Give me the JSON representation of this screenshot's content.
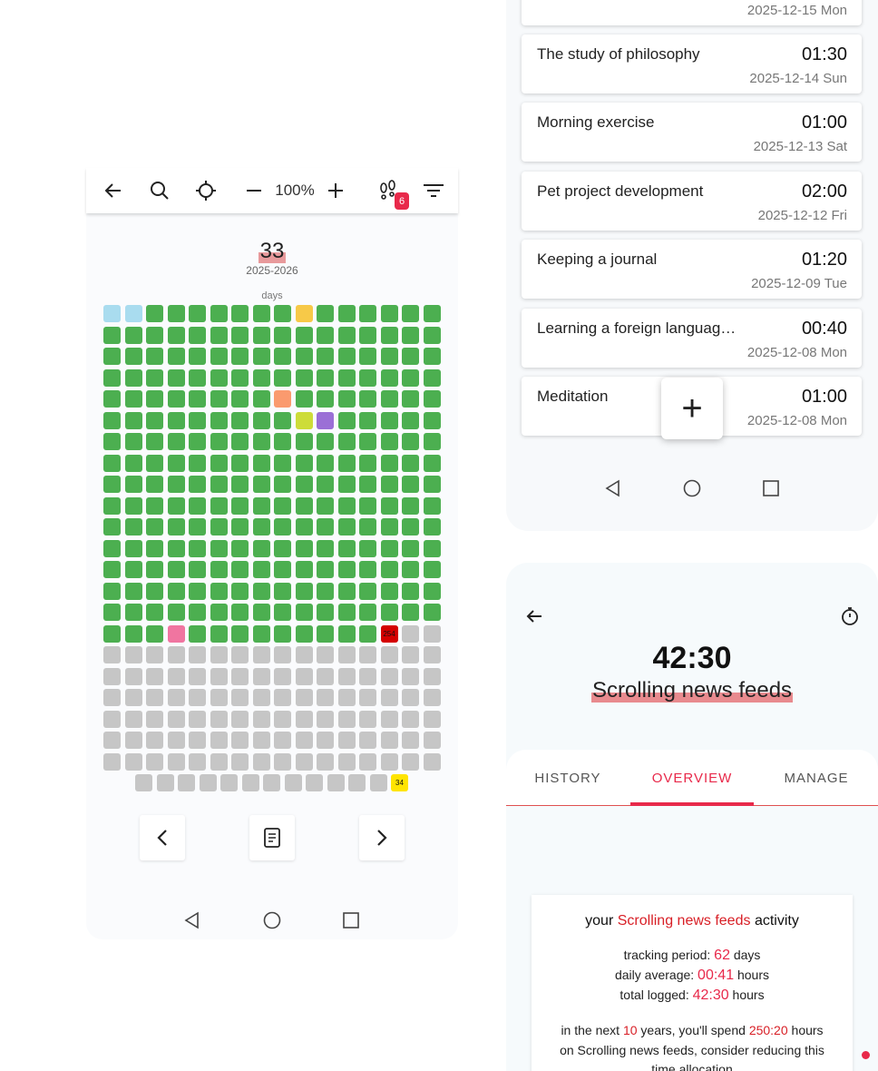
{
  "left": {
    "toolbar": {
      "zoom": "100%",
      "badge": "6",
      "icons": [
        "back-arrow-icon",
        "search-icon",
        "crosshair-icon",
        "minus-icon",
        "plus-icon",
        "footprints-icon",
        "filter-icon"
      ]
    },
    "count": "33",
    "year_range": "2025-2026",
    "days_label": "days",
    "grid": {
      "cols": 16,
      "full_rows": 15,
      "marked_cell_label": "254",
      "last_row_label": "34",
      "colors": {
        "done": "#4caf50",
        "future": "#c6c6c6",
        "sky": "#a9dcef",
        "gold": "#f7c948",
        "orange": "#fa9a6e",
        "lime": "#cddc39",
        "purple": "#9b6fd6",
        "pink": "#f075a0",
        "red": "#d40000",
        "yellow": "#ffe400"
      }
    }
  },
  "list": {
    "items": [
      {
        "title": "",
        "duration": "",
        "date": "2025-12-15 Mon"
      },
      {
        "title": "The study of philosophy",
        "duration": "01:30",
        "date": "2025-12-14 Sun"
      },
      {
        "title": "Morning exercise",
        "duration": "01:00",
        "date": "2025-12-13 Sat"
      },
      {
        "title": "Pet project development",
        "duration": "02:00",
        "date": "2025-12-12 Fri"
      },
      {
        "title": "Keeping a journal",
        "duration": "01:20",
        "date": "2025-12-09 Tue"
      },
      {
        "title": "Learning a foreign languag…",
        "duration": "00:40",
        "date": "2025-12-08 Mon"
      },
      {
        "title": "Meditation",
        "duration": "01:00",
        "date": "2025-12-08 Mon"
      }
    ],
    "fab_label": "+"
  },
  "detail": {
    "timer": "42:30",
    "activity": "Scrolling news feeds",
    "tabs": [
      "HISTORY",
      "OVERVIEW",
      "MANAGE"
    ],
    "active_tab": "OVERVIEW",
    "overview": {
      "head_prefix": "your",
      "head_activity": "Scrolling news feeds",
      "head_suffix": "activity",
      "tracking_label": "tracking period:",
      "tracking_value": "62",
      "tracking_unit": "days",
      "avg_label": "daily average:",
      "avg_value": "00:41",
      "avg_unit": "hours",
      "total_label": "total logged:",
      "total_value": "42:30",
      "total_unit": "hours",
      "proj_1": "in the next",
      "proj_years": "10",
      "proj_2": "years, you'll spend",
      "proj_hours": "250:20",
      "proj_3": "hours",
      "proj_line2": "on Scrolling news feeds, consider reducing this",
      "proj_line3": "time allocation"
    }
  }
}
